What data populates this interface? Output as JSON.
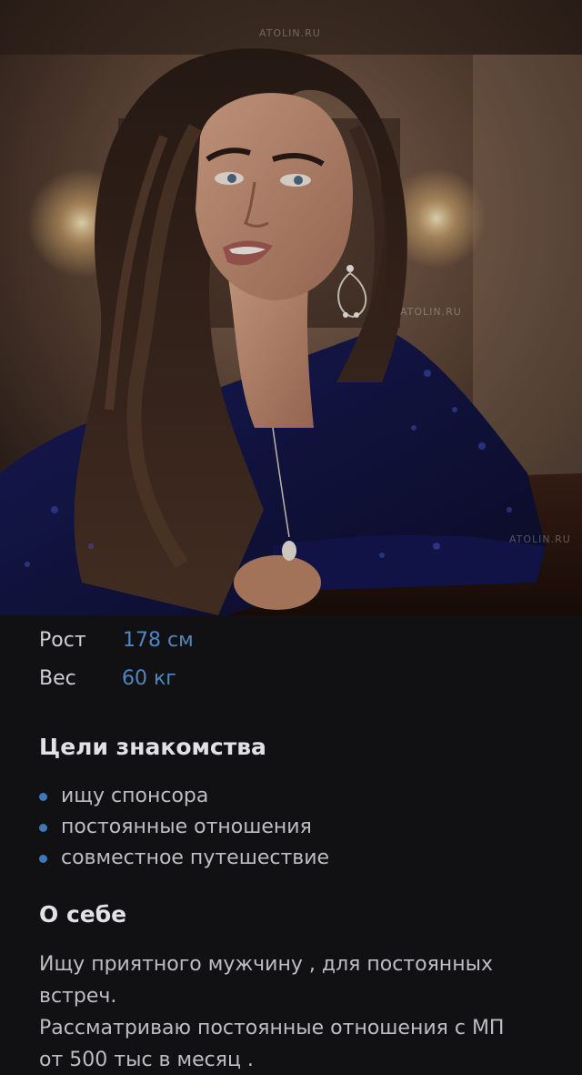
{
  "photo": {
    "alt": "Фото профиля",
    "watermark": "ATOLIN.RU"
  },
  "stats": {
    "height_label": "Рост",
    "height_value": "178 см",
    "weight_label": "Вес",
    "weight_value": "60 кг"
  },
  "goals": {
    "title": "Цели знакомства",
    "items": [
      "ищу спонсора",
      "постоянные отношения",
      "совместное путешествие"
    ]
  },
  "about": {
    "title": "О себе",
    "lines": [
      "Ищу приятного мужчину , для постоянных",
      "встреч.",
      "Рассматриваю постоянные отношения с МП",
      "от 500 тыс в месяц ."
    ]
  },
  "colors": {
    "background": "#111113",
    "accent": "#4f86c2",
    "bullet": "#3f78b8"
  }
}
